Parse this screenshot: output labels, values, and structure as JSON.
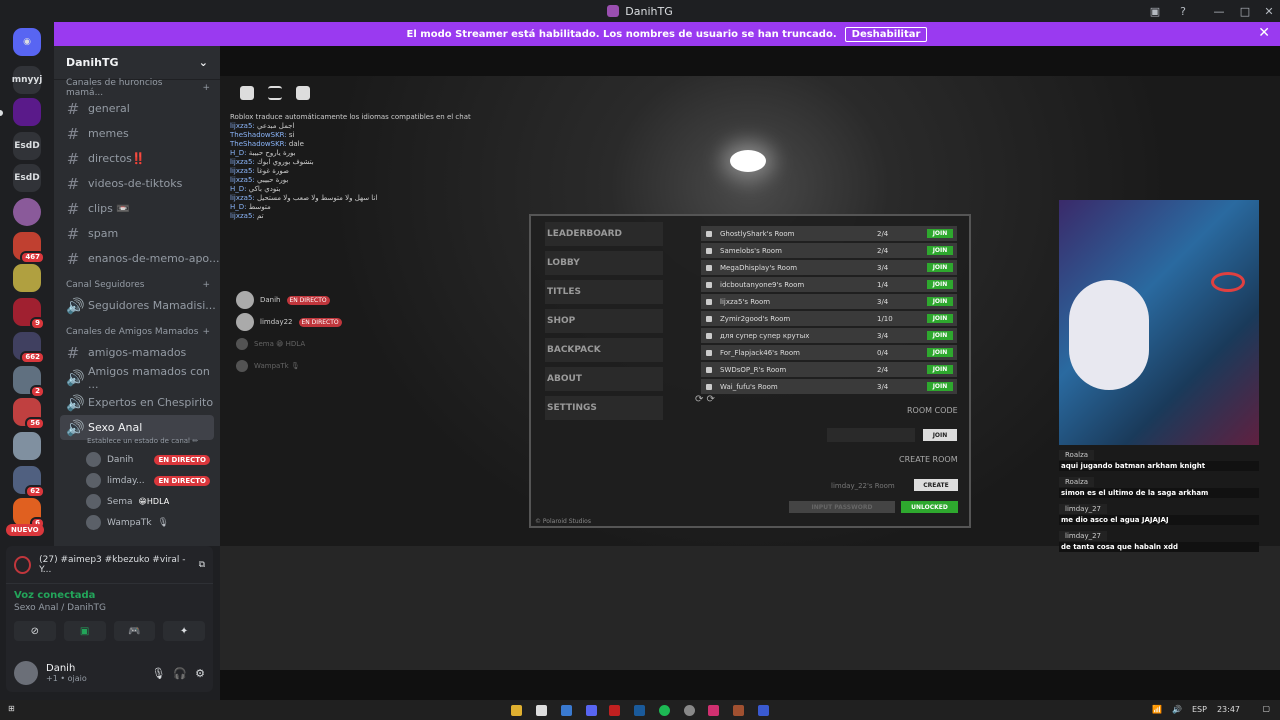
{
  "window": {
    "title": "DanihTG",
    "help": "?"
  },
  "banner": {
    "text": "El modo Streamer está habilitado. Los nombres de usuario se han truncado.",
    "button": "Deshabilitar"
  },
  "servers": [
    {
      "label": "mnyyj",
      "badge": ""
    },
    {
      "label": "EsdD",
      "badge": ""
    },
    {
      "label": "EsdD",
      "badge": ""
    },
    {
      "label": "",
      "badge": "467"
    },
    {
      "label": "",
      "badge": "9"
    },
    {
      "label": "",
      "badge": "662"
    },
    {
      "label": "",
      "badge": "2"
    },
    {
      "label": "",
      "badge": "56"
    },
    {
      "label": "",
      "badge": "62"
    },
    {
      "label": "",
      "badge": "6"
    }
  ],
  "nuevo": "NUEVO",
  "guild": {
    "name": "DanihTG"
  },
  "categories": {
    "c1": "Canales de huroncios mamá...",
    "c2": "Canal Seguidores",
    "c3": "Canales de Amigos Mamados"
  },
  "channels1": [
    "general",
    "memes",
    "directos‼️",
    "videos-de-tiktoks",
    "clips 📼",
    "spam",
    "enanos-de-memo-apo..."
  ],
  "channels2": [
    "Seguidores Mamadisi..."
  ],
  "channels3": [
    "amigos-mamados",
    "Amigos mamados con ...",
    "Expertos en Chespirito"
  ],
  "active_voice": {
    "name": "Sexo Anal",
    "status": "Establece un estado de canal ✏"
  },
  "voice_users": [
    {
      "name": "Danih",
      "live": "EN DIRECTO"
    },
    {
      "name": "limday...",
      "live": "EN DIRECTO"
    },
    {
      "name": "Sema",
      "extra": "😁HDLA"
    },
    {
      "name": "WampaTk",
      "extra": "🎙"
    }
  ],
  "youtube": {
    "title": "(27) #aimep3 #kbezuko #viral - Y..."
  },
  "voice_panel": {
    "status": "Voz conectada",
    "location": "Sexo Anal / DanihTG"
  },
  "user": {
    "name": "Danih",
    "status": "+1 • ojaio"
  },
  "roblox": {
    "chat_header": "Roblox traduce automáticamente los idiomas compatibles en el chat",
    "chat": [
      {
        "n": "lijxza5:",
        "t": "اجمل مبدعي"
      },
      {
        "n": "TheShadowSKR:",
        "t": "si"
      },
      {
        "n": "TheShadowSKR:",
        "t": "dale"
      },
      {
        "n": "H_D:",
        "t": "بورة ياروح حبيبة"
      },
      {
        "n": "lijxza5:",
        "t": "بتشوف بوروي ابوك"
      },
      {
        "n": "lijxza5:",
        "t": "صورة غوغا"
      },
      {
        "n": "lijxza5:",
        "t": "بورة حبيبي"
      },
      {
        "n": "H_D:",
        "t": "بتودي باكي"
      },
      {
        "n": "lijxza5:",
        "t": "انا سهل ولا متوسط ولا صعب ولا مستحيل"
      },
      {
        "n": "H_D:",
        "t": "متوسط"
      },
      {
        "n": "lijxza5:",
        "t": "تم"
      }
    ],
    "players": [
      {
        "name": "Danih",
        "live": "EN DIRECTO"
      },
      {
        "name": "limday22",
        "live": "EN DIRECTO"
      },
      {
        "name": "Sema 😁 HDLA",
        "live": ""
      },
      {
        "name": "WampaTk 🎙",
        "live": ""
      }
    ],
    "menu": [
      "LEADERBOARD",
      "LOBBY",
      "TITLES",
      "SHOP",
      "BACKPACK",
      "ABOUT",
      "SETTINGS"
    ],
    "rooms": [
      {
        "name": "GhostlyShark's Room",
        "players": "2/4"
      },
      {
        "name": "Samelobs's Room",
        "players": "2/4"
      },
      {
        "name": "MegaDhisplay's Room",
        "players": "3/4"
      },
      {
        "name": "idcboutanyone9's Room",
        "players": "1/4"
      },
      {
        "name": "lijxza5's Room",
        "players": "3/4"
      },
      {
        "name": "Zymir2good's Room",
        "players": "1/10"
      },
      {
        "name": "для супер супер крутых",
        "players": "3/4"
      },
      {
        "name": "For_Flapjack46's Room",
        "players": "0/4"
      },
      {
        "name": "SWDsOP_R's Room",
        "players": "2/4"
      },
      {
        "name": "Wai_fufu's Room",
        "players": "3/4"
      }
    ],
    "join": "JOIN",
    "room_code": "ROOM CODE",
    "create_room": "CREATE ROOM",
    "own_room": "limday_22's Room",
    "create": "CREATE",
    "input_password": "INPUT PASSWORD",
    "unlocked": "UNLOCKED",
    "studio": "© Polaroid Studios"
  },
  "twitch_chat": [
    {
      "user": "Roalza",
      "text": "aqui jugando batman arkham knight"
    },
    {
      "user": "Roalza",
      "text": "simon es el ultimo de la saga arkham"
    },
    {
      "user": "limday_27",
      "text": "me dio asco el agua JAJAJAJ"
    },
    {
      "user": "limday_27",
      "text": "de tanta cosa que habaln xdd"
    }
  ],
  "taskbar": {
    "lang": "ESP",
    "time": "23:47"
  }
}
